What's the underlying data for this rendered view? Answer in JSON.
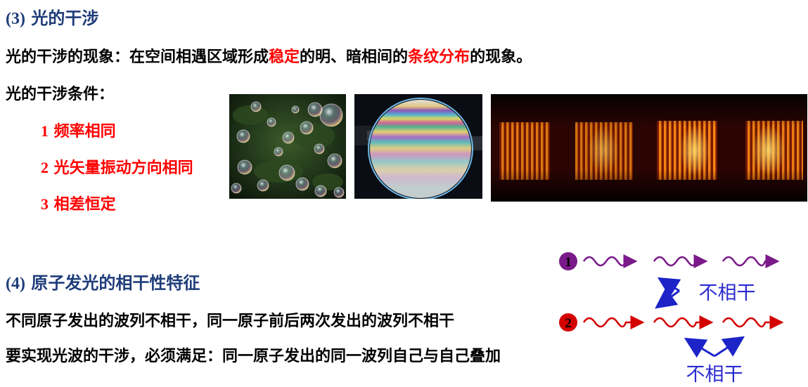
{
  "section3": {
    "number": "(3)",
    "title": "光的干涉",
    "phenomenon_prefix": "光的干涉的现象：在空间相遇区域形成",
    "phenomenon_highlight1": "稳定",
    "phenomenon_mid": "的明、暗相间的",
    "phenomenon_highlight2": "条纹分布",
    "phenomenon_suffix": "的现象。",
    "conditions_label": "光的干涉条件：",
    "conditions": [
      {
        "n": "1",
        "text": "频率相同"
      },
      {
        "n": "2",
        "text": "光矢量振动方向相同"
      },
      {
        "n": "3",
        "text": "相差恒定"
      }
    ]
  },
  "section4": {
    "number": "(4)",
    "title": "原子发光的相干性特征",
    "line1": "不同原子发出的波列不相干，同一原子前后两次发出的波列不相干",
    "line2": "要实现光波的干涉，必须满足：同一原子发出的同一波列自己与自己叠加"
  },
  "diagram": {
    "atom1": "1",
    "atom2": "2",
    "label_top": "不相干",
    "label_bottom": "不相干",
    "colors": {
      "purple": "#7a1a8a",
      "red": "#d40000",
      "blue": "#1c24c8"
    }
  }
}
